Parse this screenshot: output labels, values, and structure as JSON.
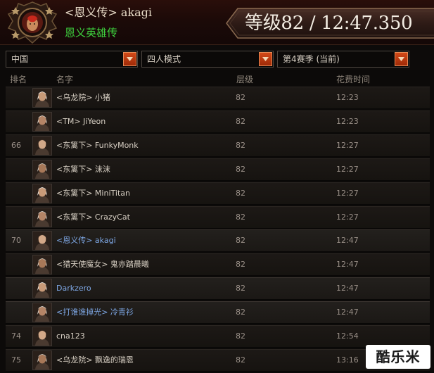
{
  "header": {
    "player_name": "<恩义传> akagi",
    "clan_name": "恩义英雄传",
    "result": "等级82 / 12:47.350",
    "emblem_icon": "clan-banner-icon"
  },
  "filters": {
    "region": "中国",
    "mode": "四人模式",
    "season": "第4赛季 (当前)",
    "dropdown_icon": "chevron-down-icon"
  },
  "table": {
    "columns": {
      "rank": "排名",
      "name": "名字",
      "level": "层级",
      "time": "花费时间"
    },
    "rows": [
      {
        "rank": "",
        "name": "<乌龙院> 小猪",
        "level": "82",
        "time": "12:23",
        "portrait": "hero-portrait-icon",
        "highlight": false
      },
      {
        "rank": "",
        "name": "<TM> JiYeon",
        "level": "82",
        "time": "12:23",
        "portrait": "hero-portrait-icon",
        "highlight": false
      },
      {
        "rank": "66",
        "name": "<东篱下> FunkyMonk",
        "level": "82",
        "time": "12:27",
        "portrait": "hero-portrait-icon",
        "highlight": false
      },
      {
        "rank": "",
        "name": "<东篱下> 沫沫",
        "level": "82",
        "time": "12:27",
        "portrait": "hero-portrait-icon",
        "highlight": false
      },
      {
        "rank": "",
        "name": "<东篱下> MiniTitan",
        "level": "82",
        "time": "12:27",
        "portrait": "hero-portrait-icon",
        "highlight": false
      },
      {
        "rank": "",
        "name": "<东篱下> CrazyCat",
        "level": "82",
        "time": "12:27",
        "portrait": "hero-portrait-icon",
        "highlight": false
      },
      {
        "rank": "70",
        "name": "<恩义传> akagi",
        "level": "82",
        "time": "12:47",
        "portrait": "hero-portrait-icon",
        "highlight": true
      },
      {
        "rank": "",
        "name": "<猎天使魔女> 鬼亦踏晨曦",
        "level": "82",
        "time": "12:47",
        "portrait": "hero-portrait-icon",
        "highlight": false
      },
      {
        "rank": "",
        "name": "Darkzero",
        "level": "82",
        "time": "12:47",
        "portrait": "hero-portrait-icon",
        "highlight": true
      },
      {
        "rank": "",
        "name": "<打谁谁掉光> 冷青衫",
        "level": "82",
        "time": "12:47",
        "portrait": "hero-portrait-icon",
        "highlight": true
      },
      {
        "rank": "74",
        "name": "cna123",
        "level": "82",
        "time": "12:54",
        "portrait": "hero-portrait-icon",
        "highlight": false
      },
      {
        "rank": "75",
        "name": "<乌龙院> 飘逸的瑞恩",
        "level": "82",
        "time": "13:16",
        "portrait": "hero-portrait-icon",
        "highlight": false
      }
    ]
  },
  "watermark": {
    "text": "酷乐米"
  },
  "colors": {
    "highlight_name": "#7ea8e6",
    "clan_green": "#3ed33e",
    "accent_orange": "#c8401a"
  }
}
